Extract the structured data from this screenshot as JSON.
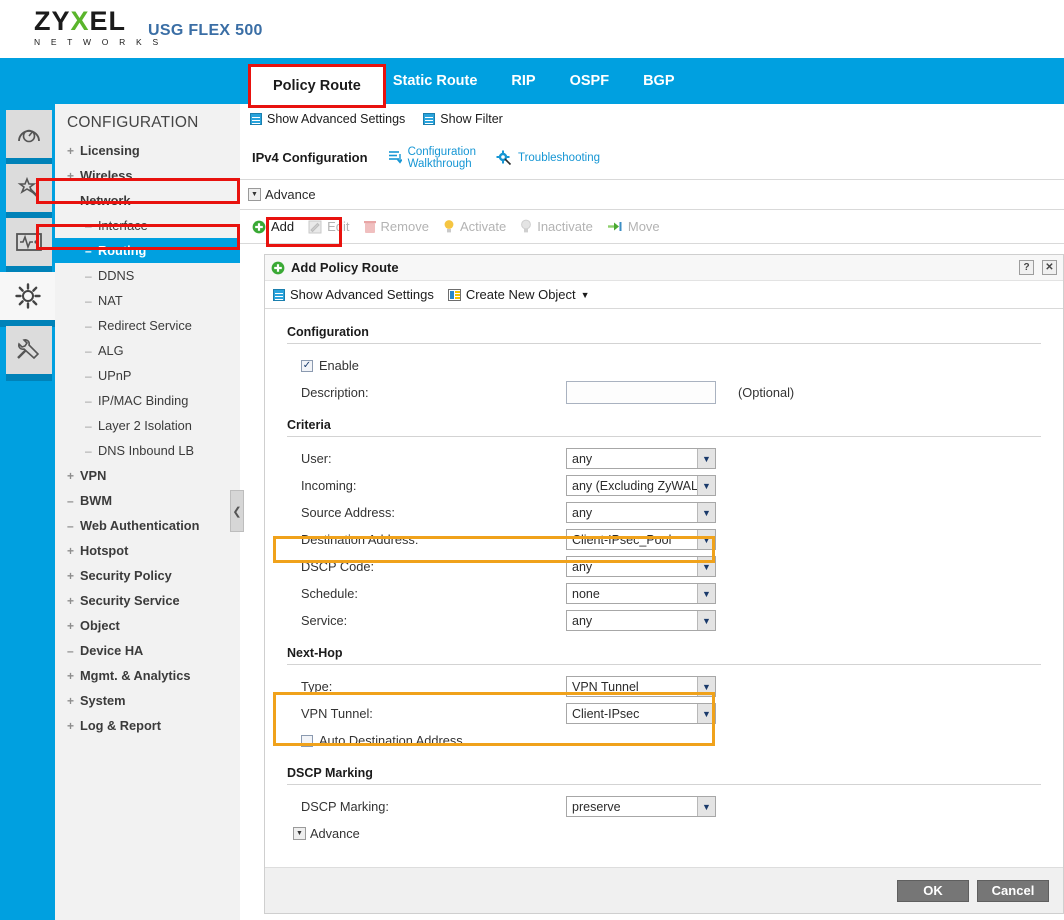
{
  "header": {
    "brand_line1": "ZY",
    "brand_x": "X",
    "brand_line1b": "EL",
    "brand_sub": "N E T W O R K S",
    "model": "USG FLEX 500"
  },
  "tabs": [
    {
      "label": "Policy Route",
      "active": true
    },
    {
      "label": "Static Route",
      "active": false
    },
    {
      "label": "RIP",
      "active": false
    },
    {
      "label": "OSPF",
      "active": false
    },
    {
      "label": "BGP",
      "active": false
    }
  ],
  "subtoolbar": {
    "show_advanced": "Show Advanced Settings",
    "show_filter": "Show Filter"
  },
  "rail": [
    {
      "name": "dashboard-icon"
    },
    {
      "name": "wizard-icon"
    },
    {
      "name": "monitor-icon"
    },
    {
      "name": "configuration-icon"
    },
    {
      "name": "maintenance-icon"
    }
  ],
  "sidebar": {
    "title": "CONFIGURATION",
    "items": [
      {
        "sign": "+",
        "label": "Licensing",
        "level": 0,
        "selected": false
      },
      {
        "sign": "+",
        "label": "Wireless",
        "level": 0,
        "selected": false
      },
      {
        "sign": "–",
        "label": "Network",
        "level": 0,
        "selected": false
      },
      {
        "sign": "–",
        "label": "Interface",
        "level": 1,
        "selected": false
      },
      {
        "sign": "–",
        "label": "Routing",
        "level": 1,
        "selected": true
      },
      {
        "sign": "–",
        "label": "DDNS",
        "level": 1,
        "selected": false
      },
      {
        "sign": "–",
        "label": "NAT",
        "level": 1,
        "selected": false
      },
      {
        "sign": "–",
        "label": "Redirect Service",
        "level": 1,
        "selected": false
      },
      {
        "sign": "–",
        "label": "ALG",
        "level": 1,
        "selected": false
      },
      {
        "sign": "–",
        "label": "UPnP",
        "level": 1,
        "selected": false
      },
      {
        "sign": "–",
        "label": "IP/MAC Binding",
        "level": 1,
        "selected": false
      },
      {
        "sign": "–",
        "label": "Layer 2 Isolation",
        "level": 1,
        "selected": false
      },
      {
        "sign": "–",
        "label": "DNS Inbound LB",
        "level": 1,
        "selected": false
      },
      {
        "sign": "+",
        "label": "VPN",
        "level": 0,
        "selected": false
      },
      {
        "sign": "–",
        "label": "BWM",
        "level": 0,
        "selected": false
      },
      {
        "sign": "–",
        "label": "Web Authentication",
        "level": 0,
        "selected": false
      },
      {
        "sign": "+",
        "label": "Hotspot",
        "level": 0,
        "selected": false
      },
      {
        "sign": "+",
        "label": "Security Policy",
        "level": 0,
        "selected": false
      },
      {
        "sign": "+",
        "label": "Security Service",
        "level": 0,
        "selected": false
      },
      {
        "sign": "+",
        "label": "Object",
        "level": 0,
        "selected": false
      },
      {
        "sign": "–",
        "label": "Device HA",
        "level": 0,
        "selected": false
      },
      {
        "sign": "+",
        "label": "Mgmt. & Analytics",
        "level": 0,
        "selected": false
      },
      {
        "sign": "+",
        "label": "System",
        "level": 0,
        "selected": false
      },
      {
        "sign": "+",
        "label": "Log & Report",
        "level": 0,
        "selected": false
      }
    ],
    "collapse_glyph": "❮"
  },
  "content": {
    "ipv4_label": "IPv4 Configuration",
    "config_walkthrough": "Configuration\nWalkthrough",
    "config_walkthrough_l1": "Configuration",
    "config_walkthrough_l2": "Walkthrough",
    "troubleshooting": "Troubleshooting",
    "advance": "Advance",
    "crud": [
      {
        "label": "Add",
        "enabled": true
      },
      {
        "label": "Edit",
        "enabled": false
      },
      {
        "label": "Remove",
        "enabled": false
      },
      {
        "label": "Activate",
        "enabled": false
      },
      {
        "label": "Inactivate",
        "enabled": false
      },
      {
        "label": "Move",
        "enabled": false
      }
    ]
  },
  "dialog": {
    "title": "Add Policy Route",
    "help_glyph": "?",
    "close_glyph": "✕",
    "show_advanced": "Show Advanced Settings",
    "create_new_object": "Create New Object",
    "create_new_object_caret": "▼",
    "sections": {
      "configuration": {
        "title": "Configuration",
        "enable_label": "Enable",
        "enable_checked": true,
        "description_label": "Description:",
        "description_value": "",
        "description_placeholder": "",
        "optional_text": "(Optional)"
      },
      "criteria": {
        "title": "Criteria",
        "rows": [
          {
            "label": "User:",
            "value": "any",
            "highlight": false
          },
          {
            "label": "Incoming:",
            "value": "any (Excluding ZyWALL)",
            "highlight": false
          },
          {
            "label": "Source Address:",
            "value": "any",
            "highlight": false
          },
          {
            "label": "Destination Address:",
            "value": "Client-IPsec_Pool",
            "highlight": true
          },
          {
            "label": "DSCP Code:",
            "value": "any",
            "highlight": false
          },
          {
            "label": "Schedule:",
            "value": "none",
            "highlight": false
          },
          {
            "label": "Service:",
            "value": "any",
            "highlight": false
          }
        ]
      },
      "next_hop": {
        "title": "Next-Hop",
        "rows": [
          {
            "label": "Type:",
            "value": "VPN Tunnel"
          },
          {
            "label": "VPN Tunnel:",
            "value": "Client-IPsec"
          }
        ],
        "auto_dest_label": "Auto Destination Address",
        "auto_dest_checked": false
      },
      "dscp_marking": {
        "title": "DSCP Marking",
        "row_label": "DSCP Marking:",
        "row_value": "preserve",
        "advance": "Advance"
      }
    },
    "footer": {
      "ok": "OK",
      "cancel": "Cancel"
    }
  },
  "colors": {
    "brand_blue": "#00a0e0",
    "brand_green": "#5ab52b",
    "highlight_red": "#e8120e",
    "highlight_orange": "#f0a21b",
    "link_blue": "#1696d4"
  }
}
